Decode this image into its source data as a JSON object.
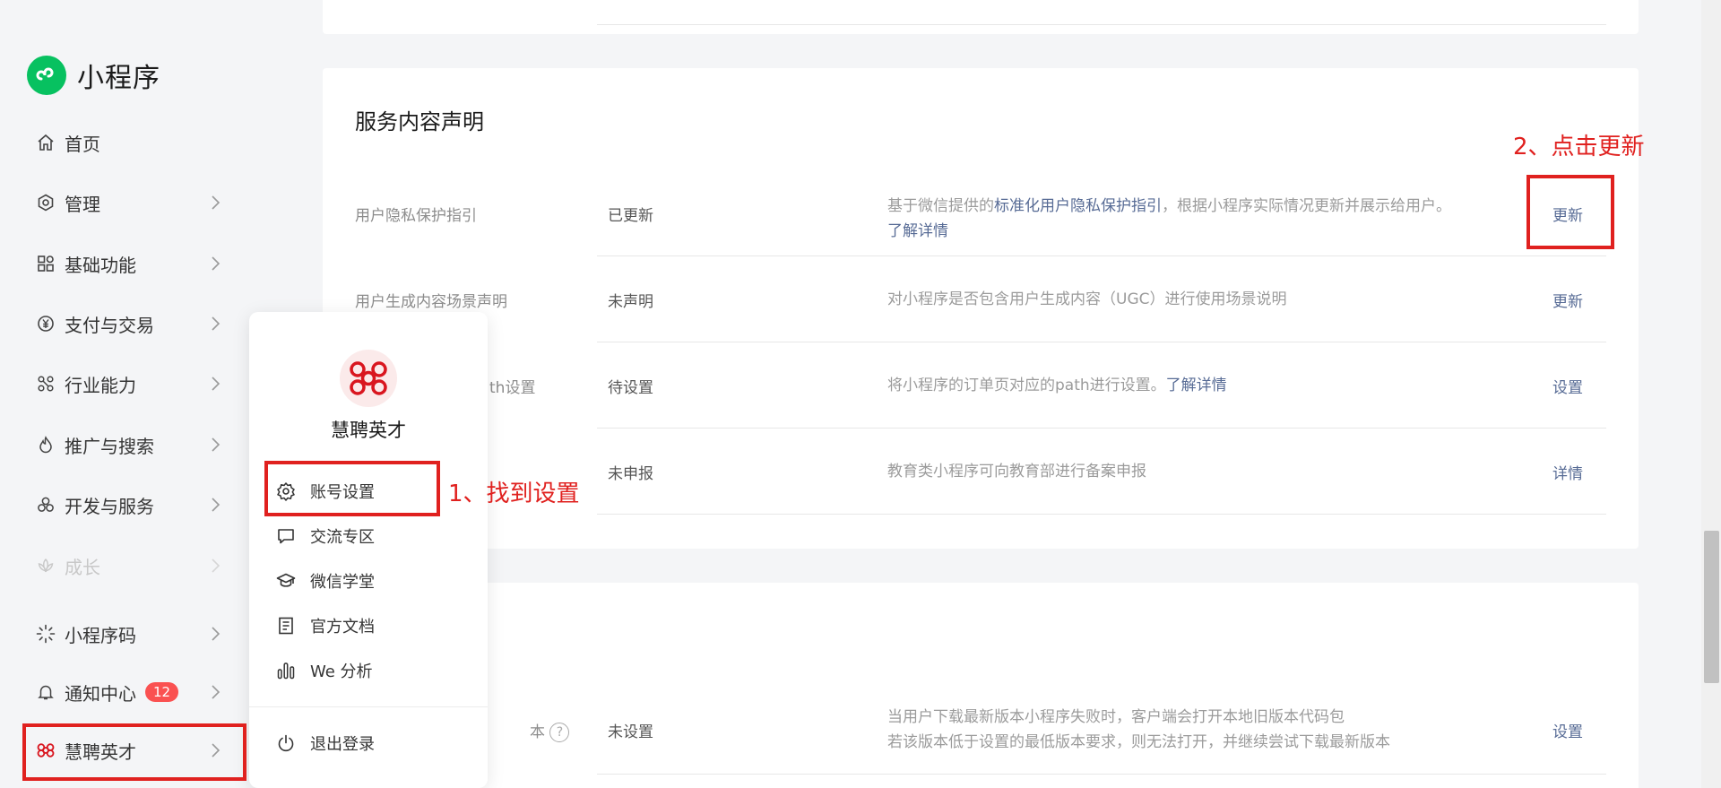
{
  "brand": {
    "name": "小程序",
    "logo_color": "#07c160"
  },
  "nav": [
    {
      "id": "home",
      "label": "首页",
      "icon": "home-icon"
    },
    {
      "id": "manage",
      "label": "管理",
      "icon": "hexagon-icon"
    },
    {
      "id": "basic",
      "label": "基础功能",
      "icon": "grid-icon"
    },
    {
      "id": "payment",
      "label": "支付与交易",
      "icon": "yen-icon"
    },
    {
      "id": "industry",
      "label": "行业能力",
      "icon": "nodes-icon"
    },
    {
      "id": "promote",
      "label": "推广与搜索",
      "icon": "flame-icon"
    },
    {
      "id": "dev",
      "label": "开发与服务",
      "icon": "cluster-icon"
    },
    {
      "id": "growth",
      "label": "成长",
      "icon": "lotus-icon",
      "disabled": true
    },
    {
      "id": "qrcode",
      "label": "小程序码",
      "icon": "sparkle-icon"
    },
    {
      "id": "notify",
      "label": "通知中心",
      "icon": "bell-icon",
      "badge": "12"
    },
    {
      "id": "account",
      "label": "慧聘英才",
      "icon": "knot-icon"
    }
  ],
  "section": {
    "title": "服务内容声明",
    "rows": [
      {
        "label": "用户隐私保护指引",
        "status": "已更新",
        "desc_prefix": "基于微信提供的",
        "desc_link1": "标准化用户隐私保护指引",
        "desc_suffix": "，根据小程序实际情况更新并展示给用户。",
        "desc_link2": "了解详情",
        "action": "更新"
      },
      {
        "label": "用户生成内容场景声明",
        "status": "未声明",
        "desc": "对小程序是否包含用户生成内容（UGC）进行使用场景说明",
        "action": "更新"
      },
      {
        "label": "th设置",
        "status": "待设置",
        "desc": "将小程序的订单页对应的path进行设置。",
        "desc_link": "了解详情",
        "action": "设置"
      },
      {
        "status": "未申报",
        "desc": "教育类小程序可向教育部进行备案申报",
        "action": "详情"
      }
    ]
  },
  "bottom_row": {
    "label": "本",
    "help": "?",
    "status": "未设置",
    "desc_line1": "当用户下载最新版本小程序失败时，客户端会打开本地旧版本代码包",
    "desc_line2": "若该版本低于设置的最低版本要求，则无法打开，并继续尝试下载最新版本",
    "action": "设置"
  },
  "popup": {
    "name": "慧聘英才",
    "items": [
      {
        "label": "账号设置",
        "icon": "gear-icon"
      },
      {
        "label": "交流专区",
        "icon": "chat-bubble-icon"
      },
      {
        "label": "微信学堂",
        "icon": "graduation-cap-icon"
      },
      {
        "label": "官方文档",
        "icon": "document-icon"
      },
      {
        "label": "We 分析",
        "icon": "bar-chart-icon"
      }
    ],
    "logout": "退出登录"
  },
  "annotations": {
    "step1": "1、找到设置",
    "step2": "2、点击更新",
    "color": "#e0211f"
  },
  "colors": {
    "link": "#576b95",
    "badge": "#fa5151",
    "knot": "#d9161f"
  }
}
